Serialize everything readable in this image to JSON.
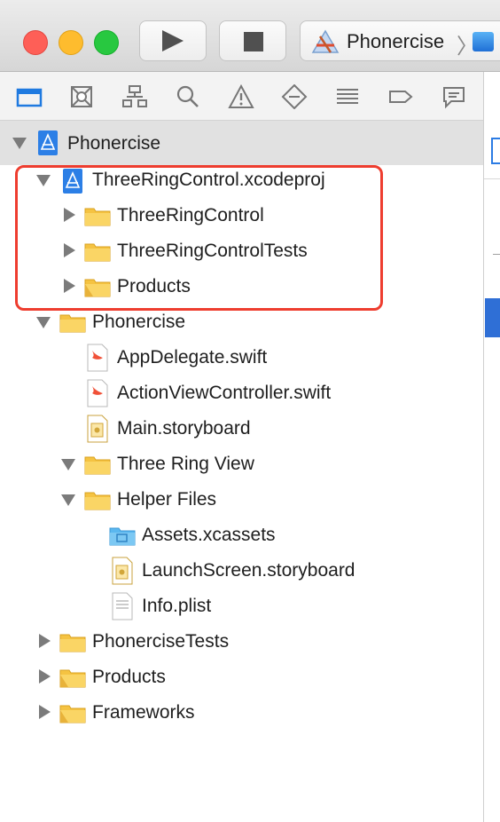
{
  "toolbar": {
    "scheme_label": "Phonercise",
    "scheme_chevron": "〉"
  },
  "navigator": {
    "icons": [
      "folder-icon",
      "source-control-icon",
      "hierarchy-icon",
      "search-icon",
      "warning-icon",
      "test-diamond-icon",
      "debug-list-icon",
      "breakpoint-tag-icon",
      "report-bubble-icon"
    ]
  },
  "tree": {
    "root": {
      "label": "Phonercise"
    },
    "subproject": {
      "label": "ThreeRingControl.xcodeproj"
    },
    "subproject_children": [
      {
        "label": "ThreeRingControl"
      },
      {
        "label": "ThreeRingControlTests"
      },
      {
        "label": "Products"
      }
    ],
    "group_phonercise": {
      "label": "Phonercise"
    },
    "files": [
      {
        "label": "AppDelegate.swift"
      },
      {
        "label": "ActionViewController.swift"
      },
      {
        "label": "Main.storyboard"
      }
    ],
    "group_three_ring_view": {
      "label": "Three Ring View"
    },
    "group_helper_files": {
      "label": "Helper Files"
    },
    "helper_files": [
      {
        "label": "Assets.xcassets"
      },
      {
        "label": "LaunchScreen.storyboard"
      },
      {
        "label": "Info.plist"
      }
    ],
    "bottom_groups": [
      {
        "label": "PhonerciseTests"
      },
      {
        "label": "Products"
      },
      {
        "label": "Frameworks"
      }
    ],
    "swift_badge": "SWIFT",
    "plist_badge": "PLIST"
  }
}
